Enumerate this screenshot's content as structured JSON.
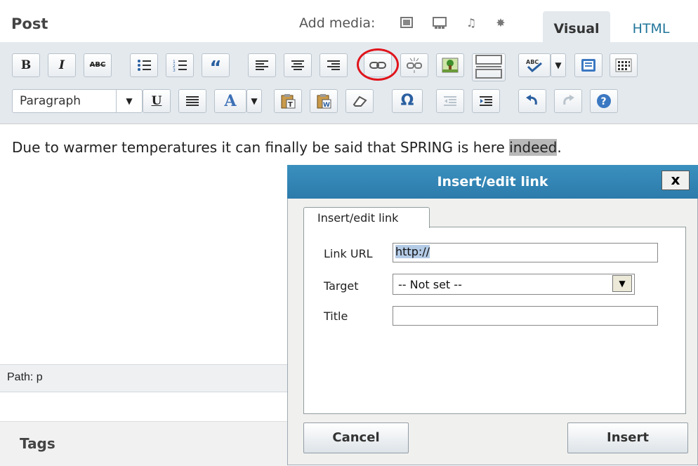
{
  "header": {
    "title": "Post",
    "add_media_label": "Add media:",
    "tabs": [
      {
        "label": "Visual",
        "active": true
      },
      {
        "label": "HTML",
        "active": false
      }
    ]
  },
  "toolbar": {
    "row1": [
      {
        "name": "bold",
        "glyph": "B"
      },
      {
        "name": "italic",
        "glyph": "I"
      },
      {
        "name": "strikethrough",
        "glyph": "ABC"
      },
      {
        "name": "bullet-list",
        "glyph": "☰"
      },
      {
        "name": "numbered-list",
        "glyph": "☰"
      },
      {
        "name": "blockquote",
        "glyph": "“"
      },
      {
        "name": "align-left",
        "glyph": "≡"
      },
      {
        "name": "align-center",
        "glyph": "≡"
      },
      {
        "name": "align-right",
        "glyph": "≡"
      },
      {
        "name": "insert-link",
        "glyph": "∞"
      },
      {
        "name": "unlink",
        "glyph": "✂"
      },
      {
        "name": "insert-image",
        "glyph": "▣"
      },
      {
        "name": "insert-more",
        "glyph": "▭"
      },
      {
        "name": "spellcheck",
        "glyph": "ABC"
      },
      {
        "name": "fullscreen",
        "glyph": "▢"
      },
      {
        "name": "kitchen-sink",
        "glyph": "▦"
      }
    ],
    "format_select": "Paragraph",
    "row2_glyphs": {
      "underline": "U",
      "justify": "≡",
      "text-color": "A",
      "omega": "Ω"
    }
  },
  "content": {
    "text_before": "Due to warmer temperatures it can finally be said that SPRING is here ",
    "text_highlighted": "indeed",
    "text_after": "."
  },
  "path": {
    "label": "Path: p"
  },
  "tags": {
    "title": "Tags"
  },
  "dialog": {
    "title": "Insert/edit link",
    "close_label": "x",
    "tab_label": "Insert/edit link",
    "fields": {
      "link_url_label": "Link URL",
      "link_url_value": "http://",
      "target_label": "Target",
      "target_value": "-- Not set --",
      "title_label": "Title",
      "title_value": ""
    },
    "buttons": {
      "cancel": "Cancel",
      "insert": "Insert"
    }
  },
  "colors": {
    "accent": "#21759b",
    "dialog_title_bg": "#2c7bab",
    "highlight_circle": "#e0141b"
  }
}
